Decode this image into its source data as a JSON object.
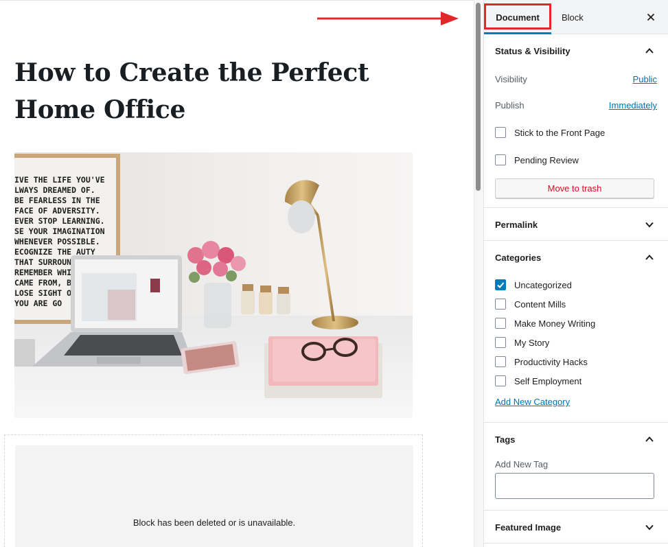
{
  "post": {
    "title_line1": "How to Create the Perfect",
    "title_line2": "Home Office"
  },
  "poster": {
    "lines": [
      "IVE THE LIFE YOU'VE",
      "LWAYS DREAMED OF.",
      "BE FEARLESS IN THE",
      "FACE OF ADVERSITY.",
      "EVER STOP LEARNING.",
      "SE YOUR IMAGINATION",
      "WHENEVER POSSIBLE.",
      "ECOGNIZE THE    AUTY",
      "THAT SURROUN",
      "REMEMBER WHI",
      "CAME FROM, BU",
      "LOSE SIGHT OF",
      "YOU ARE GO"
    ]
  },
  "missing_block": {
    "message": "Block has been deleted or is unavailable."
  },
  "sidebar": {
    "tabs": {
      "document": "Document",
      "block": "Block"
    },
    "status": {
      "title": "Status & Visibility",
      "visibility_label": "Visibility",
      "visibility_value": "Public",
      "publish_label": "Publish",
      "publish_value": "Immediately",
      "sticky_label": "Stick to the Front Page",
      "pending_label": "Pending Review",
      "trash_label": "Move to trash"
    },
    "permalink": {
      "title": "Permalink"
    },
    "categories": {
      "title": "Categories",
      "items": [
        {
          "label": "Uncategorized",
          "checked": true
        },
        {
          "label": "Content Mills",
          "checked": false
        },
        {
          "label": "Make Money Writing",
          "checked": false
        },
        {
          "label": "My Story",
          "checked": false
        },
        {
          "label": "Productivity Hacks",
          "checked": false
        },
        {
          "label": "Self Employment",
          "checked": false
        }
      ],
      "add_new": "Add New Category"
    },
    "tags": {
      "title": "Tags",
      "add_label": "Add New Tag",
      "input_value": ""
    },
    "featured_image": {
      "title": "Featured Image"
    }
  },
  "colors": {
    "accent": "#007cba",
    "link": "#0073aa",
    "annotation_red": "#e3262a",
    "trash_red": "#d40d21"
  }
}
